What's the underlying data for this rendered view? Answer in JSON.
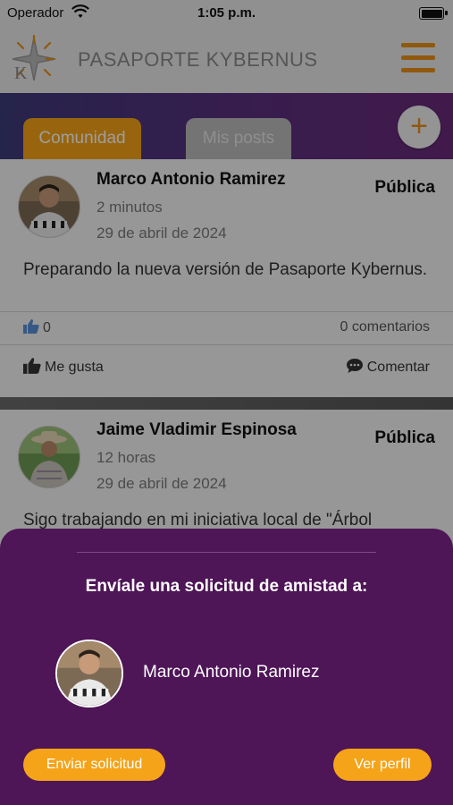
{
  "status_bar": {
    "carrier": "Operador",
    "time": "1:05 p.m."
  },
  "header": {
    "title": "PASAPORTE KYBERNUS"
  },
  "tabs": [
    {
      "label": "Comunidad",
      "active": true
    },
    {
      "label": "Mis posts",
      "active": false
    }
  ],
  "fab": {
    "label": "+"
  },
  "posts": [
    {
      "author": "Marco Antonio Ramirez",
      "time_ago": "2 minutos",
      "date": "29 de abril de 2024",
      "visibility": "Pública",
      "text": "Preparando la nueva versión de Pasaporte Kybernus.",
      "likes": "0",
      "comments": "0 comentarios",
      "like_label": "Me gusta",
      "comment_label": "Comentar"
    },
    {
      "author": "Jaime Vladimir Espinosa",
      "time_ago": "12 horas",
      "date": "29 de abril de 2024",
      "visibility": "Pública",
      "text": "Sigo trabajando en mi iniciativa local de \"Árbol"
    }
  ],
  "sheet": {
    "heading": "Envíale una solicitud de amistad a:",
    "name": "Marco Antonio Ramirez",
    "send_label": "Enviar solicitud",
    "profile_label": "Ver perfil"
  },
  "colors": {
    "accent": "#f5a318",
    "sheet_bg": "#4e1557",
    "header_bg": "#e9e9e9"
  }
}
